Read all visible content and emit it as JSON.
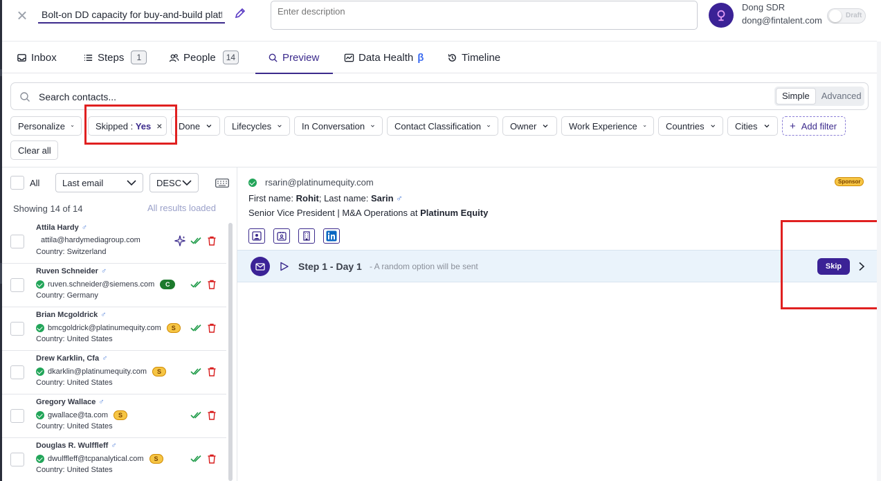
{
  "header": {
    "title_value": "Bolt-on DD capacity for buy-and-build platform",
    "description_placeholder": "Enter description",
    "user_name": "Dong SDR",
    "user_email": "dong@fintalent.com",
    "status_toggle_label": "Draft"
  },
  "tabs": [
    {
      "label": "Inbox",
      "icon": "inbox-icon"
    },
    {
      "label": "Steps",
      "icon": "list-icon",
      "count": "1"
    },
    {
      "label": "People",
      "icon": "people-icon",
      "count": "14"
    },
    {
      "label": "Preview",
      "icon": "search-icon",
      "active": true
    },
    {
      "label": "Data Health",
      "icon": "data-health-icon",
      "suffix": "β"
    },
    {
      "label": "Timeline",
      "icon": "history-icon"
    }
  ],
  "search": {
    "placeholder": "Search contacts...",
    "mode_simple": "Simple",
    "mode_advanced": "Advanced",
    "selected_mode": "Simple"
  },
  "filters": {
    "personalize": "Personalize",
    "skipped_label": "Skipped",
    "skipped_sep": " : ",
    "skipped_value": "Yes",
    "done": "Done",
    "lifecycles": "Lifecycles",
    "in_conversation": "In Conversation",
    "contact_classification": "Contact Classification",
    "owner": "Owner",
    "work_experience": "Work Experience",
    "countries": "Countries",
    "cities": "Cities",
    "add_filter": "Add filter",
    "clear_all": "Clear all"
  },
  "list_controls": {
    "all_label": "All",
    "sort_field": "Last email",
    "sort_order": "DESC",
    "showing": "Showing 14 of 14",
    "loaded": "All results loaded"
  },
  "contacts": [
    {
      "name": "Attila Hardy",
      "gender": "♂",
      "email": "attila@hardymediagroup.com",
      "verified": false,
      "badge": "",
      "country": "Country: Switzerland",
      "ai": true
    },
    {
      "name": "Ruven Schneider",
      "gender": "♂",
      "email": "ruven.schneider@siemens.com",
      "verified": true,
      "badge": "C",
      "country": "Country: Germany"
    },
    {
      "name": "Brian Mcgoldrick",
      "gender": "♂",
      "email": "bmcgoldrick@platinumequity.com",
      "verified": true,
      "badge": "S",
      "country": "Country: United States"
    },
    {
      "name": "Drew Karklin, Cfa",
      "gender": "♂",
      "email": "dkarklin@platinumequity.com",
      "verified": true,
      "badge": "S",
      "country": "Country: United States"
    },
    {
      "name": "Gregory Wallace",
      "gender": "♂",
      "email": "gwallace@ta.com",
      "verified": true,
      "badge": "S",
      "country": "Country: United States"
    },
    {
      "name": "Douglas R. Wulffleff",
      "gender": "♂",
      "email": "dwulffleff@tcpanalytical.com",
      "verified": true,
      "badge": "S",
      "country": "Country: United States"
    }
  ],
  "detail": {
    "email": "rsarin@platinumequity.com",
    "tag": "Sponsor",
    "first_name_label": "First name: ",
    "first_name": "Rohit",
    "last_name_label": "; Last name: ",
    "last_name": "Sarin",
    "gender": "♂",
    "role": "Senior Vice President | M&A Operations at ",
    "company": "Platinum Equity",
    "step_title": "Step 1 - Day 1",
    "step_note": "- A random option will be sent",
    "skip_label": "Skip"
  },
  "colors": {
    "accent": "#3b2a8c",
    "annotation_red": "#e02020",
    "verified_green": "#22a559"
  }
}
